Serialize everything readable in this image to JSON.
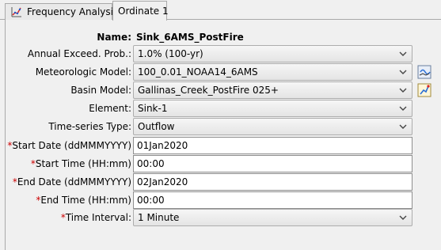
{
  "tabs": [
    {
      "label": "Frequency Analysis",
      "icon": "frequency-analysis-icon"
    },
    {
      "label": "Ordinate 1"
    }
  ],
  "form": {
    "name_label": "Name:",
    "name_value": "Sink_6AMS_PostFire",
    "annual_exceed_label": "Annual Exceed. Prob.:",
    "annual_exceed_value": "1.0% (100-yr)",
    "met_model_label": "Meteorologic Model:",
    "met_model_value": "100_0.01_NOAA14_6AMS",
    "basin_model_label": "Basin Model:",
    "basin_model_value": "Gallinas_Creek_PostFire 025+",
    "element_label": "Element:",
    "element_value": "Sink-1",
    "timeseries_type_label": "Time-series Type:",
    "timeseries_type_value": "Outflow",
    "required_marker": "*",
    "start_date_label": "Start Date (ddMMMYYYY)",
    "start_date_value": "01Jan2020",
    "start_time_label": "Start Time (HH:mm)",
    "start_time_value": "00:00",
    "end_date_label": "End Date (ddMMMYYYY)",
    "end_date_value": "02Jan2020",
    "end_time_label": "End Time (HH:mm)",
    "end_time_value": "00:00",
    "time_interval_label": "Time Interval:",
    "time_interval_value": "1 Minute"
  },
  "colors": {
    "required": "#cc0000",
    "background": "#f0f0f0"
  }
}
